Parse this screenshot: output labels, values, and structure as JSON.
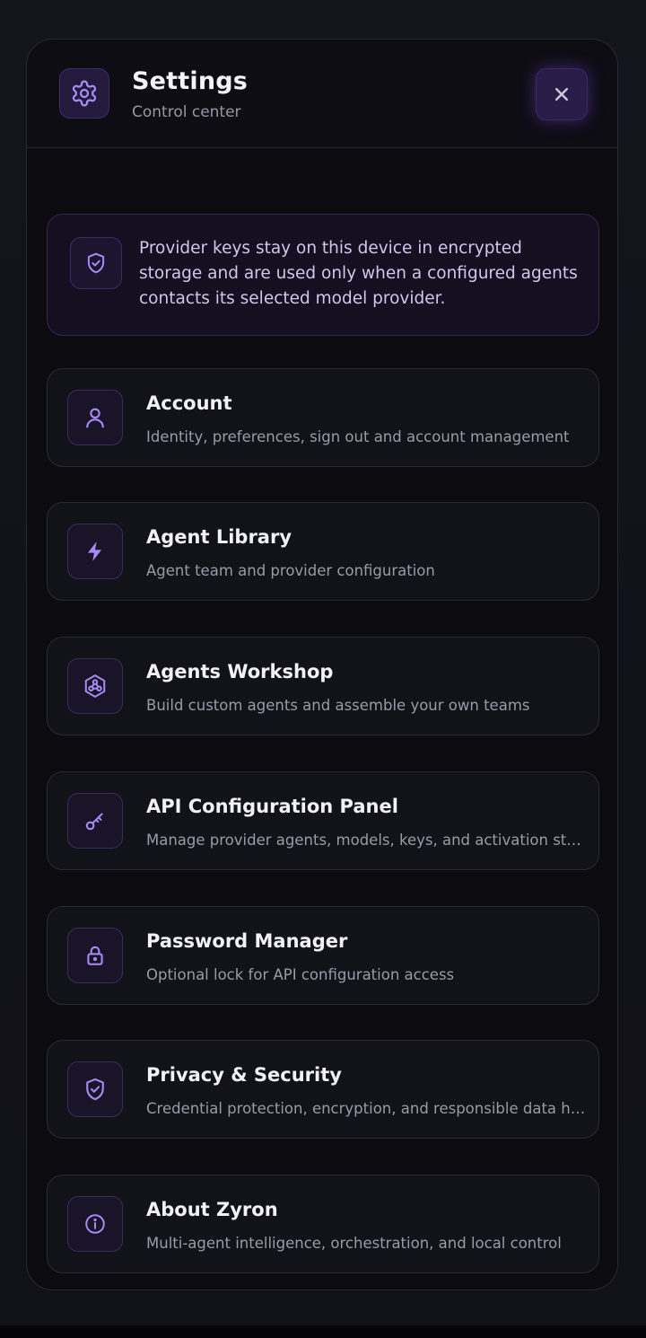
{
  "header": {
    "title": "Settings",
    "subtitle": "Control center",
    "icon": "gear-icon",
    "close_icon": "close-icon"
  },
  "notice": {
    "icon": "shield-check-icon",
    "text": "Provider keys stay on this device in encrypted storage and are used only when a configured agents contacts its selected model provider."
  },
  "items": [
    {
      "icon": "user-icon",
      "title": "Account",
      "description": "Identity, preferences, sign out and account management"
    },
    {
      "icon": "lightning-icon",
      "title": "Agent Library",
      "description": "Agent team and provider configuration"
    },
    {
      "icon": "hexagon-network-icon",
      "title": "Agents Workshop",
      "description": "Build custom agents and assemble your own teams"
    },
    {
      "icon": "key-icon",
      "title": "API Configuration Panel",
      "description": "Manage provider agents, models, keys, and activation state"
    },
    {
      "icon": "lock-icon",
      "title": "Password Manager",
      "description": "Optional lock for API configuration access"
    },
    {
      "icon": "shield-check-icon",
      "title": "Privacy & Security",
      "description": "Credential protection, encryption, and responsible data handling"
    },
    {
      "icon": "info-icon",
      "title": "About Zyron",
      "description": "Multi-agent intelligence, orchestration, and local control"
    }
  ],
  "colors": {
    "accent": "#a98bf5",
    "background": "#0b0b10",
    "card": "#121219"
  }
}
